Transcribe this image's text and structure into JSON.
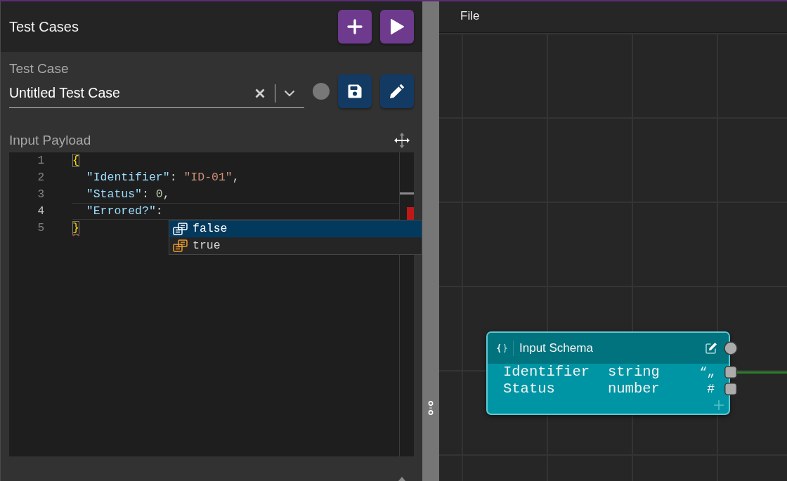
{
  "header": {
    "title": "Test Cases"
  },
  "test_case": {
    "label": "Test Case",
    "value": "Untitled Test Case"
  },
  "payload": {
    "label": "Input Payload",
    "lines": [
      {
        "number": "1",
        "active": false,
        "error": false,
        "tokens": [
          {
            "kind": "bracket",
            "text": "{"
          }
        ]
      },
      {
        "number": "2",
        "active": false,
        "error": false,
        "tokens": [
          {
            "kind": "key",
            "text": "  \"Identifier\""
          },
          {
            "kind": "plain",
            "text": ": "
          },
          {
            "kind": "string",
            "text": "\"ID-01\""
          },
          {
            "kind": "plain",
            "text": ","
          }
        ]
      },
      {
        "number": "3",
        "active": false,
        "error": false,
        "tokens": [
          {
            "kind": "key",
            "text": "  \"Status\""
          },
          {
            "kind": "plain",
            "text": ": "
          },
          {
            "kind": "number",
            "text": "0"
          },
          {
            "kind": "plain",
            "text": ","
          }
        ]
      },
      {
        "number": "4",
        "active": true,
        "error": false,
        "tokens": [
          {
            "kind": "key",
            "text": "  \"Errored?\""
          },
          {
            "kind": "plain",
            "text": ":"
          }
        ]
      },
      {
        "number": "5",
        "active": false,
        "error": true,
        "tokens": [
          {
            "kind": "bracket",
            "text": "}"
          }
        ]
      }
    ],
    "suggestions": [
      {
        "text": "false",
        "selected": true
      },
      {
        "text": "true",
        "selected": false
      }
    ]
  },
  "menu": {
    "items": [
      "File"
    ]
  },
  "node": {
    "title": "Input Schema",
    "fields": [
      {
        "name": "Identifier",
        "type": "string",
        "glyph": "“„"
      },
      {
        "name": "Status",
        "type": "number",
        "glyph": "#"
      }
    ]
  }
}
